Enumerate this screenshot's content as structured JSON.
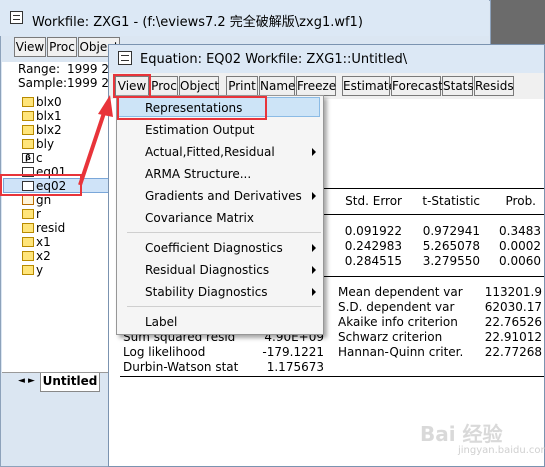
{
  "workfile": {
    "title": "Workfile: ZXG1 - (f:\\eviews7.2 完全破解版\\zxg1.wf1)",
    "toolbar": [
      "View",
      "Proc",
      "Object"
    ],
    "range_label": "Range:",
    "range_value": "1999 20",
    "sample_label": "Sample:",
    "sample_value": "1999 20",
    "objects": [
      "blx0",
      "blx1",
      "blx2",
      "bly",
      "c",
      "eq01",
      "eq02",
      "gn",
      "r",
      "resid",
      "x1",
      "x2",
      "y"
    ],
    "tab": "Untitled"
  },
  "equation": {
    "title": "Equation: EQ02   Workfile: ZXG1::Untitled\\",
    "toolbar": [
      "View",
      "Proc",
      "Object",
      "Print",
      "Name",
      "Freeze",
      "Estimate",
      "Forecast",
      "Stats",
      "Resids"
    ],
    "coef_headers": [
      "Std. Error",
      "t-Statistic",
      "Prob."
    ],
    "coef_rows": [
      [
        "0.091922",
        "0.972941",
        "0.3483"
      ],
      [
        "0.242983",
        "5.265078",
        "0.0002"
      ],
      [
        "0.284515",
        "3.279550",
        "0.0060"
      ]
    ],
    "stats_left": [
      [
        "Sum squared resid",
        "4.90E+09"
      ],
      [
        "Log likelihood",
        "-179.1221"
      ],
      [
        "Durbin-Watson stat",
        "1.175673"
      ]
    ],
    "stats_right": [
      [
        "Mean dependent var",
        "113201.9"
      ],
      [
        "S.D. dependent var",
        "62030.17"
      ],
      [
        "Akaike info criterion",
        "22.76526"
      ],
      [
        "Schwarz criterion",
        "22.91012"
      ],
      [
        "Hannan-Quinn criter.",
        "22.77268"
      ]
    ]
  },
  "view_menu": {
    "items": [
      "Representations",
      "Estimation Output",
      "Actual,Fitted,Residual",
      "ARMA Structure...",
      "Gradients and Derivatives",
      "Covariance Matrix",
      "Coefficient Diagnostics",
      "Residual Diagnostics",
      "Stability Diagnostics",
      "Label"
    ]
  },
  "watermark": {
    "text": "Bai 经验",
    "sub": "jingyan.baidu.com"
  },
  "colors": {
    "annotation_red": "#e8343a",
    "menu_highlight": "#cde4f7",
    "titlebar": "#dce8f5"
  }
}
